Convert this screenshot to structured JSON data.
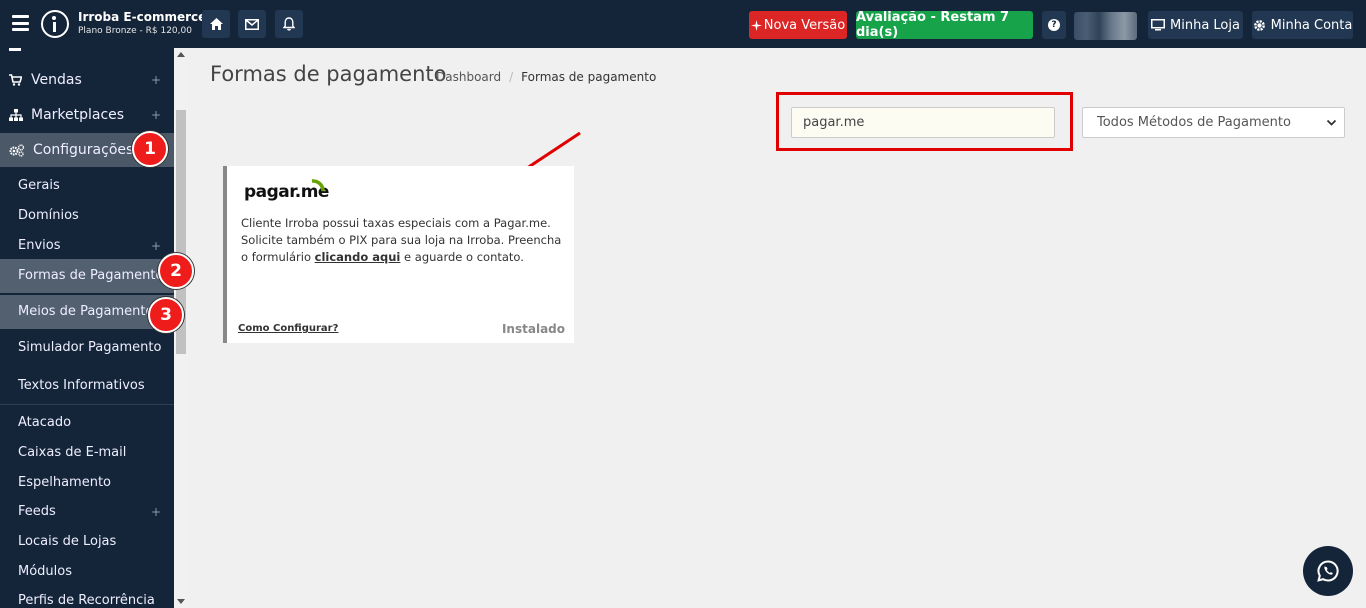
{
  "brand": {
    "name": "Irroba E-commerce",
    "plan": "Plano Bronze - R$ 120,00"
  },
  "topbar": {
    "icons": [
      "home-icon",
      "mail-icon",
      "bell-icon"
    ],
    "new_version": "Nova Versão",
    "trial": "Avaliação - Restam 7 dia(s)",
    "help": "?",
    "my_store": "Minha Loja",
    "my_account": "Minha Conta"
  },
  "sidebar": {
    "top_items": [
      {
        "label": "Vendas",
        "icon": "cart-icon"
      },
      {
        "label": "Marketplaces",
        "icon": "sitemap-icon"
      },
      {
        "label": "Configurações",
        "icon": "cogs-icon"
      }
    ],
    "sub_items": [
      {
        "label": "Gerais"
      },
      {
        "label": "Domínios"
      },
      {
        "label": "Envios"
      },
      {
        "label": "Formas de Pagamento"
      },
      {
        "label": "Meios de Pagamento"
      },
      {
        "label": "Simulador Pagamento"
      },
      {
        "label": "Textos Informativos"
      }
    ],
    "other_items": [
      {
        "label": "Atacado"
      },
      {
        "label": "Caixas de E-mail"
      },
      {
        "label": "Espelhamento"
      },
      {
        "label": "Feeds"
      },
      {
        "label": "Locais de Lojas"
      },
      {
        "label": "Módulos"
      },
      {
        "label": "Perfis de Recorrência"
      }
    ],
    "plus": "+"
  },
  "badges": [
    "1",
    "2",
    "3"
  ],
  "main": {
    "title": "Formas de pagamento",
    "breadcrumb": {
      "home": "Dashboard",
      "sep": "/",
      "current": "Formas de pagamento"
    },
    "search": {
      "value": "pagar.me"
    },
    "filter": {
      "selected": "Todos Métodos de Pagamento"
    },
    "card": {
      "logo": "pagar.me",
      "text_before": "Cliente Irroba possui taxas especiais com a Pagar.me. Solicite também o PIX para sua loja na Irroba. Preencha o formulário ",
      "link": "clicando aqui",
      "text_after": " e aguarde o contato.",
      "how_config": "Como Configurar?",
      "status": "Instalado"
    }
  },
  "colors": {
    "topbar": "#14253a",
    "red_button": "#dc2626",
    "green_button": "#16a34a",
    "highlight": "#e00000",
    "badge": "#ef1c1c"
  }
}
